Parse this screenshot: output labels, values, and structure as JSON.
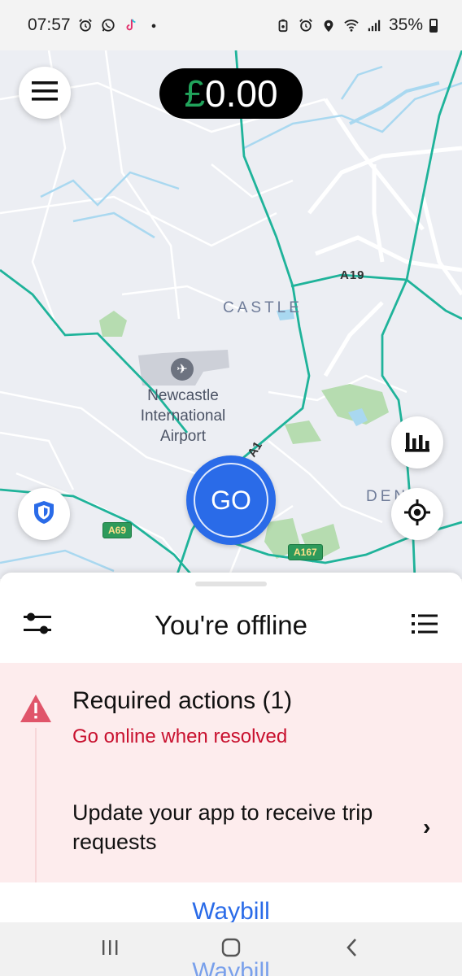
{
  "status_bar": {
    "time": "07:57",
    "battery": "35%",
    "icons_left": [
      "alarm-icon",
      "whatsapp-icon",
      "tiktok-icon",
      "dot-icon"
    ],
    "icons_right": [
      "lock-battery-icon",
      "alarm-icon",
      "location-icon",
      "wifi-icon",
      "signal-icon",
      "battery-icon"
    ]
  },
  "map": {
    "earnings": {
      "currency": "£",
      "amount": "0.00"
    },
    "area_labels": {
      "castle": "CASTLE",
      "den": "DEN"
    },
    "airport_label": "Newcastle International Airport",
    "roads": {
      "a19": "A19",
      "a1": "A1",
      "a69": "A69",
      "a167": "A167"
    },
    "go_label": "GO",
    "buttons": [
      "menu-icon",
      "earnings-chart-icon",
      "safety-shield-icon",
      "locate-icon"
    ]
  },
  "sheet": {
    "title": "You're offline",
    "required": {
      "title": "Required actions (1)",
      "subtitle": "Go online when resolved",
      "action": "Update your app to receive trip requests"
    },
    "waybill": "Waybill"
  },
  "colors": {
    "go_blue": "#2a6be8",
    "currency_green": "#21a35b",
    "alert_red": "#c8102e",
    "card_pink": "#fdeced",
    "road_teal": "#1fb39a"
  }
}
